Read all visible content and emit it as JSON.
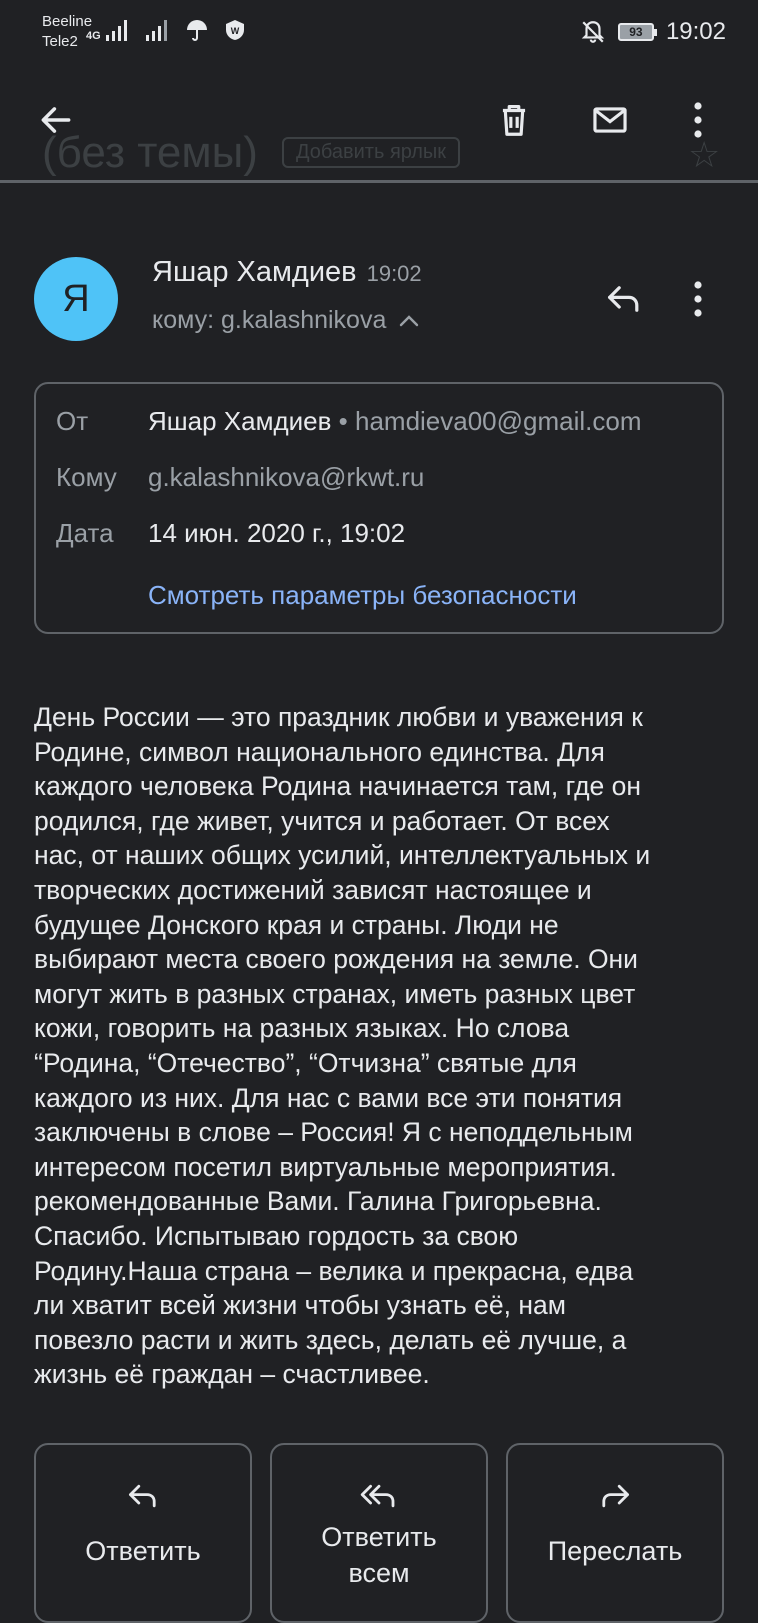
{
  "status_bar": {
    "carrier_1": "Beeline",
    "carrier_2": "Tele2",
    "network_type": "4G",
    "battery": "93",
    "time": "19:02"
  },
  "app_bar": {
    "subject": "(без темы)",
    "add_label": "Добавить ярлык"
  },
  "message": {
    "avatar_letter": "Я",
    "sender_name": "Яшар Хамдиев",
    "time": "19:02",
    "recipient_short": "кому: g.kalashnikova"
  },
  "details": {
    "from_label": "От",
    "from_name": "Яшар Хамдиев",
    "from_sep": " • ",
    "from_email": "hamdieva00@gmail.com",
    "to_label": "Кому",
    "to_value": "g.kalashnikova@rkwt.ru",
    "date_label": "Дата",
    "date_value": "14 июн. 2020 г., 19:02",
    "security_link": "Смотреть параметры безопасности"
  },
  "body_lines": [
    "День России — это праздник любви и уважения к",
    "Родине, символ национального единства. Для",
    "каждого человека Родина начинается там, где он",
    "родился, где живет, учится и работает. От всех",
    "нас, от наших общих усилий, интеллектуальных и",
    "творческих достижений зависят настоящее и",
    "будущее Донского края и страны. Люди не",
    "выбирают места своего рождения на земле. Они",
    "могут жить в разных странах, иметь разных цвет",
    "кожи, говорить на разных языках. Но слова",
    "“Родина, “Отечество”, “Отчизна” святые для",
    "каждого из них. Для нас с вами все эти понятия",
    "заключены в слове – Россия! Я с неподдельным",
    "интересом посетил виртуальные мероприятия.",
    "рекомендованные Вами. Галина Григорьевна.",
    "Спасибо. Испытываю гордость за свою",
    "Родину.Наша страна – велика и прекрасна, едва",
    "ли хватит всей жизни чтобы узнать её, нам",
    "повезло расти и жить здесь, делать её лучше, а",
    "жизнь её граждан – счастливее."
  ],
  "actions": {
    "reply": "Ответить",
    "reply_all": "Ответить всем",
    "forward": "Переслать"
  },
  "icons": {
    "back": "arrow-left-icon",
    "delete": "trash-icon",
    "unread": "mail-icon",
    "more": "more-vert-icon",
    "reply": "reply-icon",
    "reply_all": "reply-all-icon",
    "forward": "forward-icon",
    "star": "star-icon",
    "collapse": "chevron-up-icon"
  },
  "colors": {
    "background": "#202124",
    "text": "#e8eaed",
    "secondary_text": "#9aa0a6",
    "link": "#8ab4f8",
    "avatar": "#4fc3f7",
    "border": "#5f6368"
  }
}
